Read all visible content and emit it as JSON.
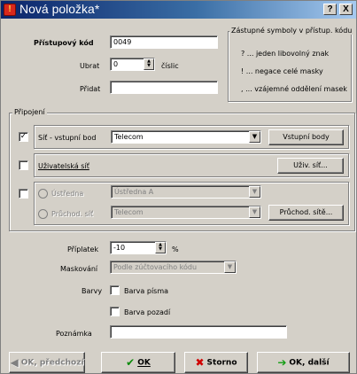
{
  "window": {
    "title": "Nová položka*",
    "help_label": "?",
    "close_label": "X"
  },
  "form": {
    "access_code": {
      "label": "Přístupový kód",
      "value": "0049"
    },
    "remove": {
      "label": "Ubrat",
      "value": "0",
      "unit": "číslic"
    },
    "add": {
      "label": "Přidat",
      "value": ""
    }
  },
  "wildcards": {
    "title": "Zástupné symboly v přístup. kódu",
    "lines": [
      "? ... jeden libovolný znak",
      "! ... negace celé masky",
      ", ... vzájemné oddělení masek"
    ]
  },
  "connection": {
    "group_label": "Připojení",
    "network_entry": {
      "checked": true,
      "check_glyph": "✓",
      "label": "Síť - vstupní bod",
      "value": "Telecom",
      "button": "Vstupní body"
    },
    "user_network": {
      "checked": false,
      "label": "Uživatelská síť",
      "button": "Uživ. síť..."
    },
    "exchange": {
      "checked": false,
      "label": "Ústředna",
      "value": "Ústředna A"
    },
    "transit_network": {
      "label": "Průchod. síť",
      "value": "Telecom",
      "button": "Průchod. sítě..."
    }
  },
  "extra": {
    "surcharge": {
      "label": "Příplatek",
      "value": "-10",
      "unit": "%"
    },
    "masking": {
      "label": "Maskování",
      "value": "Podle zúčtovacího kódu"
    },
    "colors": {
      "label": "Barvy",
      "font_color": "Barva písma",
      "background_color": "Barva pozadí"
    },
    "note": {
      "label": "Poznámka",
      "value": ""
    }
  },
  "buttons": {
    "ok_previous": "OK, předchozí",
    "ok": "OK",
    "cancel": "Storno",
    "ok_next": "OK, další"
  },
  "icons": {
    "dropdown": "▼",
    "spin_up": "▲",
    "spin_down": "▼",
    "ok_check": "✔",
    "cancel_x": "✖",
    "arrow_left": "◀",
    "arrow_right": "➔"
  },
  "colors": {
    "title_start": "#0a246a",
    "title_end": "#a6caf0",
    "ok_green": "#0a8a0a",
    "cancel_red": "#d00000",
    "next_green": "#129d12"
  }
}
